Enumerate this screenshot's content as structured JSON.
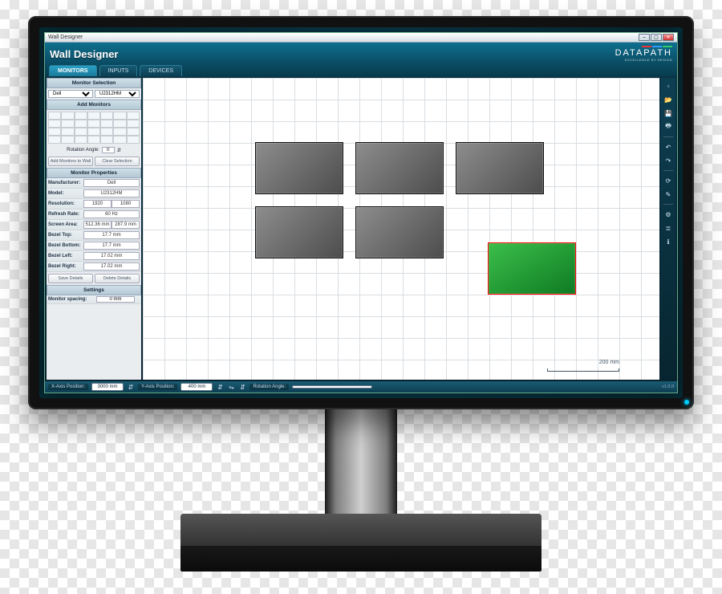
{
  "window": {
    "title": "Wall Designer"
  },
  "header": {
    "product": "Wall Designer",
    "brand_name": "DATAPATH",
    "brand_tag": "EXCELLENCE BY DESIGN"
  },
  "tabs": [
    {
      "label": "MONITORS",
      "active": true
    },
    {
      "label": "INPUTS",
      "active": false
    },
    {
      "label": "DEVICES",
      "active": false
    }
  ],
  "sidebar": {
    "monitor_selection_hdr": "Monitor Selection",
    "brand_select": "Dell",
    "model_select": "U2312HM",
    "add_monitors_hdr": "Add Monitors",
    "rotation_label": "Rotation Angle:",
    "rotation_value": "0",
    "add_to_wall_btn": "Add Monitors to Wall",
    "clear_btn": "Clear Selection",
    "monitor_properties_hdr": "Monitor Properties",
    "props": {
      "manufacturer_lbl": "Manufacturer:",
      "manufacturer_val": "Dell",
      "model_lbl": "Model:",
      "model_val": "U2312HM",
      "resolution_lbl": "Resolution:",
      "resolution_w": "1920",
      "resolution_h": "1080",
      "refresh_lbl": "Refresh Rate:",
      "refresh_val": "60 Hz",
      "screen_lbl": "Screen Area:",
      "screen_w": "512.36 mm",
      "screen_h": "287.9 mm",
      "bezel_top_lbl": "Bezel Top:",
      "bezel_top_val": "17.7 mm",
      "bezel_bottom_lbl": "Bezel Bottom:",
      "bezel_bottom_val": "17.7 mm",
      "bezel_left_lbl": "Bezel Left:",
      "bezel_left_val": "17.02 mm",
      "bezel_right_lbl": "Bezel Right:",
      "bezel_right_val": "17.02 mm"
    },
    "save_btn": "Save Details",
    "delete_btn": "Delete Details",
    "settings_hdr": "Settings",
    "spacing_lbl": "Monitor spacing:",
    "spacing_val": "0 mm"
  },
  "canvas": {
    "scale_label": "200 mm"
  },
  "toolbar_icons": [
    "new",
    "open",
    "save",
    "print",
    "sep",
    "undo",
    "redo",
    "sep",
    "rotate",
    "edit",
    "sep",
    "settings",
    "layers",
    "info"
  ],
  "footer": {
    "x_lbl": "X-Axis Position:",
    "x_val": "3000 mm",
    "y_lbl": "Y-Axis Position:",
    "y_val": "400 mm",
    "rot_lbl": "Rotation Angle:",
    "rot_val": "",
    "version": "v1.6.0"
  }
}
